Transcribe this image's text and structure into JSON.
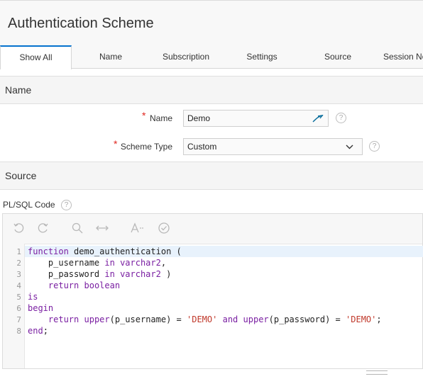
{
  "page": {
    "title": "Authentication Scheme"
  },
  "tabs": [
    "Show All",
    "Name",
    "Subscription",
    "Settings",
    "Source",
    "Session No"
  ],
  "name_region": {
    "heading": "Name",
    "name_label": "Name",
    "name_value": "Demo",
    "scheme_label": "Scheme Type",
    "scheme_value": "Custom"
  },
  "source_region": {
    "heading": "Source",
    "plsql_label": "PL/SQL Code"
  },
  "toolbar": {
    "icons": [
      "undo-icon",
      "redo-icon",
      "search-icon",
      "replace-icon",
      "autocomplete-icon",
      "validate-icon"
    ]
  },
  "code": {
    "line_numbers": [
      "1",
      "2",
      "3",
      "4",
      "5",
      "6",
      "7",
      "8"
    ],
    "l1_kw": "function",
    "l1_rest": " demo_authentication (",
    "l2_a": "    p_username ",
    "l2_kw1": "in",
    "l2_sp": " ",
    "l2_kw2": "varchar2",
    "l2_b": ",",
    "l3_a": "    p_password ",
    "l3_kw1": "in",
    "l3_sp": " ",
    "l3_kw2": "varchar2",
    "l3_b": " )",
    "l4_a": "    ",
    "l4_kw1": "return",
    "l4_sp": " ",
    "l4_kw2": "boolean",
    "l5_kw": "is",
    "l6_kw": "begin",
    "l7_a": "    ",
    "l7_kw1": "return",
    "l7_sp": " ",
    "l7_kw2": "upper",
    "l7_b": "(p_username) = ",
    "l7_s1": "'DEMO'",
    "l7_sp2": " ",
    "l7_kw3": "and",
    "l7_sp3": " ",
    "l7_kw4": "upper",
    "l7_c": "(p_password) = ",
    "l7_s2": "'DEMO'",
    "l7_d": ";",
    "l8_kw": "end",
    "l8_b": ";"
  }
}
